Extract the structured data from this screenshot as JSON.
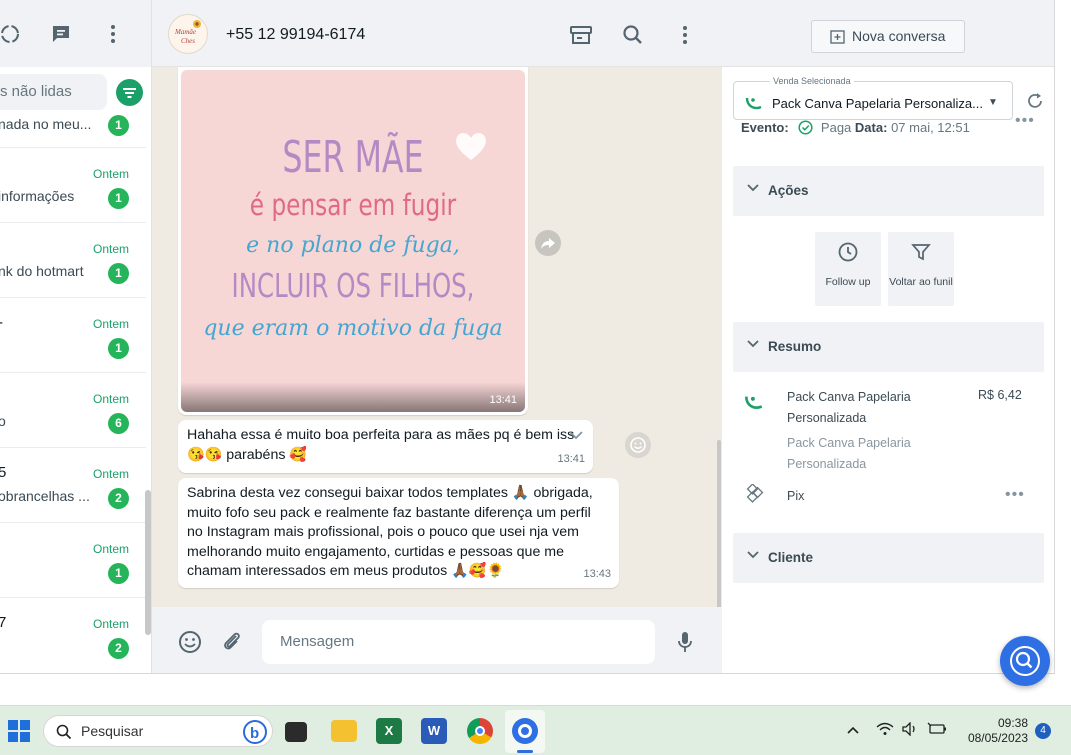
{
  "sidebar": {
    "search_placeholder": "s não lidas",
    "chats": [
      {
        "name": "",
        "preview": "nada no meu...",
        "time": "",
        "badge": "1"
      },
      {
        "name": "",
        "preview": "informações",
        "time": "Ontem",
        "badge": "1"
      },
      {
        "name": "",
        "preview": "nk do hotmart",
        "time": "Ontem",
        "badge": "1"
      },
      {
        "name": "-",
        "preview": "",
        "time": "Ontem",
        "badge": "1"
      },
      {
        "name": "",
        "preview": "o",
        "time": "Ontem",
        "badge": "6"
      },
      {
        "name": "5",
        "preview": "obrancelhas ...",
        "time": "Ontem",
        "badge": "2"
      },
      {
        "name": "",
        "preview": "",
        "time": "Ontem",
        "badge": "1"
      },
      {
        "name": "7",
        "preview": "",
        "time": "Ontem",
        "badge": "2"
      }
    ]
  },
  "chat": {
    "contact_phone": "+55 12 99194-6174",
    "avatar_text": "Mamãe Ches",
    "image_message": {
      "lines": [
        "SER MÃE",
        "é pensar em fugir",
        "e no plano de fuga,",
        "INCLUIR OS FILHOS,",
        "que eram o motivo da fuga"
      ],
      "time": "13:41"
    },
    "messages": [
      {
        "text": "Hahaha essa é muito boa perfeita para as mães pq é bem iss",
        "text2": "😘😘 parabéns 🥰",
        "time": "13:41"
      },
      {
        "text": "Sabrina desta vez consegui baixar todos templates 🙏🏾 obrigada, muito fofo seu pack e realmente faz bastante diferença um perfil no Instagram mais profissional, pois o pouco que usei nja vem melhorando muito engajamento, curtidas e pessoas que me chamam interessados em meus produtos 🙏🏾🥰🌻",
        "time": "13:43"
      }
    ],
    "input_placeholder": "Mensagem"
  },
  "panel": {
    "new_chat_label": "Nova conversa",
    "sale_legend": "Venda Selecionada",
    "sale_value": "Pack Canva Papelaria Personaliza...",
    "evento_label": "Evento:",
    "evento_status": "Paga",
    "data_label": "Data:",
    "data_value": "07 mai, 12:51",
    "sections": {
      "acoes": "Ações",
      "resumo": "Resumo",
      "cliente": "Cliente"
    },
    "actions": [
      {
        "label": "Follow up",
        "icon": "clock-icon"
      },
      {
        "label": "Voltar ao funil",
        "icon": "funnel-icon"
      }
    ],
    "resumo": {
      "product_name": "Pack Canva Papelaria Personalizada",
      "product_sub": "Pack Canva Papelaria Personalizada",
      "price": "R$ 6,42",
      "payment": "Pix"
    }
  },
  "taskbar": {
    "search_label": "Pesquisar",
    "time": "09:38",
    "date": "08/05/2023",
    "notifications": "4"
  },
  "colors": {
    "accent_green": "#1ca06a",
    "badge_green": "#25b45a",
    "fab_blue": "#2f6fe4"
  }
}
